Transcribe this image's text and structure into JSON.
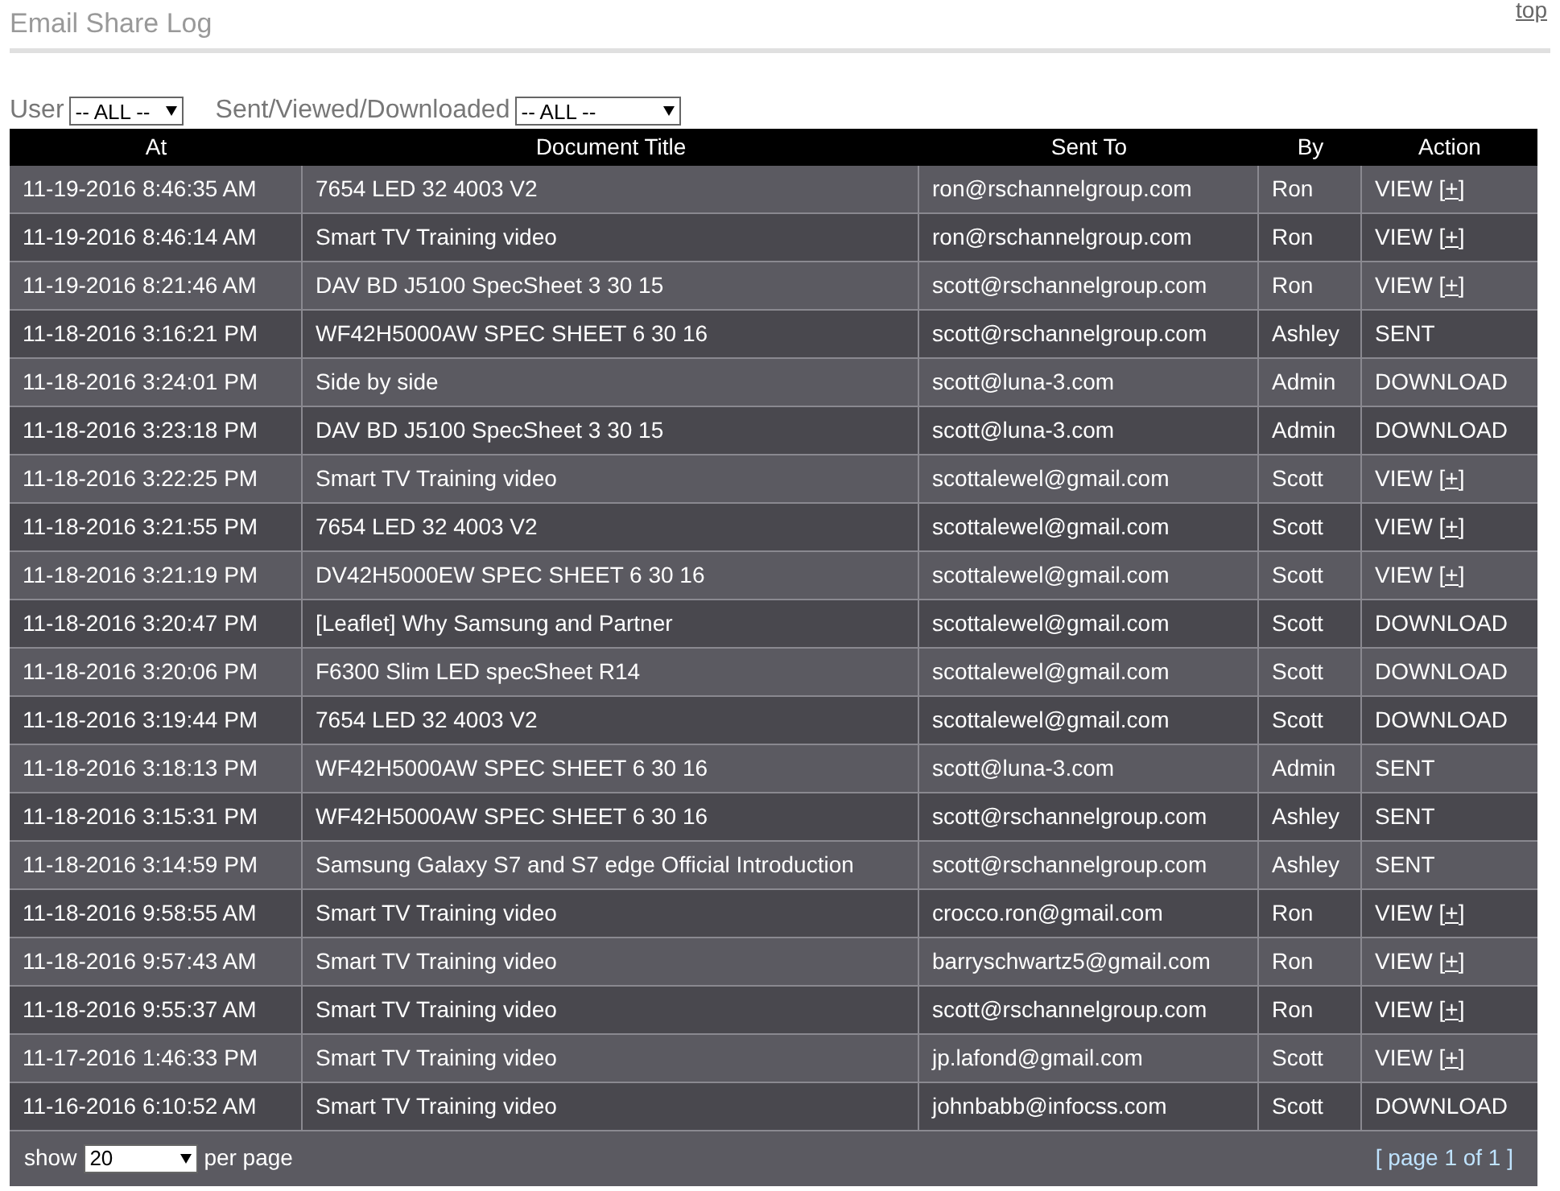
{
  "page": {
    "title": "Email Share Log",
    "top_link": "top"
  },
  "filters": [
    {
      "label": "User",
      "value": "-- ALL --"
    },
    {
      "label": "Sent/Viewed/Downloaded",
      "value": "-- ALL --"
    }
  ],
  "table": {
    "columns": [
      "At",
      "Document Title",
      "Sent To",
      "By",
      "Action"
    ],
    "rows": [
      {
        "at": "11-19-2016 8:46:35 AM",
        "title": "7654 LED 32 4003 V2",
        "sent_to": "ron@rschannelgroup.com",
        "by": "Ron",
        "action": "VIEW",
        "link": "[+]"
      },
      {
        "at": "11-19-2016 8:46:14 AM",
        "title": "Smart TV Training video",
        "sent_to": "ron@rschannelgroup.com",
        "by": "Ron",
        "action": "VIEW",
        "link": "[+]"
      },
      {
        "at": "11-19-2016 8:21:46 AM",
        "title": "DAV BD J5100 SpecSheet 3 30 15",
        "sent_to": "scott@rschannelgroup.com",
        "by": "Ron",
        "action": "VIEW",
        "link": "[+]"
      },
      {
        "at": "11-18-2016 3:16:21 PM",
        "title": "WF42H5000AW SPEC SHEET 6 30 16",
        "sent_to": "scott@rschannelgroup.com",
        "by": "Ashley",
        "action": "SENT"
      },
      {
        "at": "11-18-2016 3:24:01 PM",
        "title": "Side by side",
        "sent_to": "scott@luna-3.com",
        "by": "Admin",
        "action": "DOWNLOAD"
      },
      {
        "at": "11-18-2016 3:23:18 PM",
        "title": "DAV BD J5100 SpecSheet 3 30 15",
        "sent_to": "scott@luna-3.com",
        "by": "Admin",
        "action": "DOWNLOAD"
      },
      {
        "at": "11-18-2016 3:22:25 PM",
        "title": "Smart TV Training video",
        "sent_to": "scottalewel@gmail.com",
        "by": "Scott",
        "action": "VIEW",
        "link": "[+]"
      },
      {
        "at": "11-18-2016 3:21:55 PM",
        "title": "7654 LED 32 4003 V2",
        "sent_to": "scottalewel@gmail.com",
        "by": "Scott",
        "action": "VIEW",
        "link": "[+]"
      },
      {
        "at": "11-18-2016 3:21:19 PM",
        "title": "DV42H5000EW SPEC SHEET 6 30 16",
        "sent_to": "scottalewel@gmail.com",
        "by": "Scott",
        "action": "VIEW",
        "link": "[+]"
      },
      {
        "at": "11-18-2016 3:20:47 PM",
        "title": "[Leaflet] Why Samsung and Partner",
        "sent_to": "scottalewel@gmail.com",
        "by": "Scott",
        "action": "DOWNLOAD"
      },
      {
        "at": "11-18-2016 3:20:06 PM",
        "title": "F6300 Slim LED specSheet R14",
        "sent_to": "scottalewel@gmail.com",
        "by": "Scott",
        "action": "DOWNLOAD"
      },
      {
        "at": "11-18-2016 3:19:44 PM",
        "title": "7654 LED 32 4003 V2",
        "sent_to": "scottalewel@gmail.com",
        "by": "Scott",
        "action": "DOWNLOAD"
      },
      {
        "at": "11-18-2016 3:18:13 PM",
        "title": "WF42H5000AW SPEC SHEET 6 30 16",
        "sent_to": "scott@luna-3.com",
        "by": "Admin",
        "action": "SENT"
      },
      {
        "at": "11-18-2016 3:15:31 PM",
        "title": "WF42H5000AW SPEC SHEET 6 30 16",
        "sent_to": "scott@rschannelgroup.com",
        "by": "Ashley",
        "action": "SENT"
      },
      {
        "at": "11-18-2016 3:14:59 PM",
        "title": "Samsung Galaxy S7 and S7 edge Official Introduction",
        "sent_to": "scott@rschannelgroup.com",
        "by": "Ashley",
        "action": "SENT"
      },
      {
        "at": "11-18-2016 9:58:55 AM",
        "title": "Smart TV Training video",
        "sent_to": "crocco.ron@gmail.com",
        "by": "Ron",
        "action": "VIEW",
        "link": "[+]"
      },
      {
        "at": "11-18-2016 9:57:43 AM",
        "title": "Smart TV Training video",
        "sent_to": "barryschwartz5@gmail.com",
        "by": "Ron",
        "action": "VIEW",
        "link": "[+]"
      },
      {
        "at": "11-18-2016 9:55:37 AM",
        "title": "Smart TV Training video",
        "sent_to": "scott@rschannelgroup.com",
        "by": "Ron",
        "action": "VIEW",
        "link": "[+]"
      },
      {
        "at": "11-17-2016 1:46:33 PM",
        "title": "Smart TV Training video",
        "sent_to": "jp.lafond@gmail.com",
        "by": "Scott",
        "action": "VIEW",
        "link": "[+]"
      },
      {
        "at": "11-16-2016 6:10:52 AM",
        "title": "Smart TV Training video",
        "sent_to": "johnbabb@infocss.com",
        "by": "Scott",
        "action": "DOWNLOAD"
      }
    ]
  },
  "footer": {
    "show_label": "show",
    "per_page_value": "20",
    "per_page_label": "per page",
    "pagination": "[ page 1 of 1 ]"
  }
}
